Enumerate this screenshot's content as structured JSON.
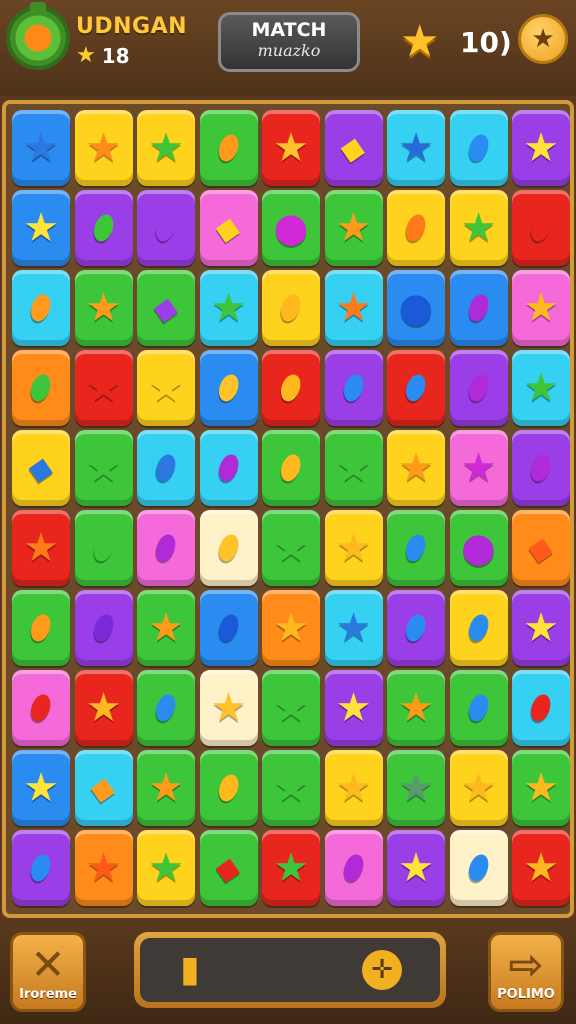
{
  "header": {
    "player_name": "UDNGAN",
    "stars": "18",
    "title_main": "MATCH",
    "title_sub": "muazko",
    "moves": "10)",
    "gear_icon": "gear-icon",
    "star_icon": "star-icon"
  },
  "colors": {
    "blue": "#2a8cf0",
    "cyan": "#35d0f2",
    "yellow": "#ffd21e",
    "green": "#3ec63a",
    "red": "#e8261e",
    "purple": "#9a3ee8",
    "pink": "#f36ad8",
    "orange": "#ff8c1a",
    "cream": "#fff1c8"
  },
  "gems": {
    "star": "★",
    "drop": "⬮",
    "diamond": "◆",
    "circle": "●"
  },
  "board": [
    [
      [
        "blue",
        "star",
        "#2a78e0"
      ],
      [
        "yellow",
        "star",
        "#ff8c1a"
      ],
      [
        "yellow",
        "star",
        "#3ec63a"
      ],
      [
        "green",
        "drop",
        "#ff9a1a"
      ],
      [
        "red",
        "star",
        "#ffc22a"
      ],
      [
        "purple",
        "diamond",
        "#ffd21e"
      ],
      [
        "cyan",
        "star",
        "#2a6ad8"
      ],
      [
        "cyan",
        "drop",
        "#2a8cf0"
      ],
      [
        "purple",
        "star",
        "#ffe23a"
      ]
    ],
    [
      [
        "blue",
        "star",
        "#ffe23a"
      ],
      [
        "purple",
        "drop",
        "#3ec63a"
      ],
      [
        "purple",
        "drop",
        "#9a3ee8"
      ],
      [
        "pink",
        "diamond",
        "#ffd21e"
      ],
      [
        "green",
        "circle",
        "#d02ad8"
      ],
      [
        "green",
        "star",
        "#ff9a1a"
      ],
      [
        "yellow",
        "drop",
        "#ff7a1a"
      ],
      [
        "yellow",
        "star",
        "#3ec63a"
      ],
      [
        "red",
        "drop",
        "#e8261e"
      ]
    ],
    [
      [
        "cyan",
        "drop",
        "#ff9a1a"
      ],
      [
        "green",
        "star",
        "#ff9a1a"
      ],
      [
        "green",
        "diamond",
        "#9a3ee8"
      ],
      [
        "cyan",
        "star",
        "#3ec63a"
      ],
      [
        "yellow",
        "drop",
        "#ffb81e"
      ],
      [
        "cyan",
        "star",
        "#ff7a1a"
      ],
      [
        "blue",
        "circle",
        "#1a5ad8"
      ],
      [
        "blue",
        "drop",
        "#b02ad8"
      ],
      [
        "pink",
        "star",
        "#ffb81e"
      ]
    ],
    [
      [
        "orange",
        "drop",
        "#3ec63a"
      ],
      [
        "red",
        "star",
        "#e8261e"
      ],
      [
        "yellow",
        "star",
        "#ffd21e"
      ],
      [
        "blue",
        "drop",
        "#ffc22a"
      ],
      [
        "red",
        "drop",
        "#ffb81e"
      ],
      [
        "purple",
        "drop",
        "#2a8cf0"
      ],
      [
        "red",
        "drop",
        "#2a8cf0"
      ],
      [
        "purple",
        "drop",
        "#b02ad8"
      ],
      [
        "cyan",
        "star",
        "#3ec63a"
      ]
    ],
    [
      [
        "yellow",
        "diamond",
        "#2a78e0"
      ],
      [
        "green",
        "star",
        "#3ec63a"
      ],
      [
        "cyan",
        "drop",
        "#2a78e0"
      ],
      [
        "cyan",
        "drop",
        "#b02ad8"
      ],
      [
        "green",
        "drop",
        "#ffb81e"
      ],
      [
        "green",
        "star",
        "#3ec63a"
      ],
      [
        "yellow",
        "star",
        "#ff9a1a"
      ],
      [
        "pink",
        "star",
        "#d02ad8"
      ],
      [
        "purple",
        "drop",
        "#b02ad8"
      ]
    ],
    [
      [
        "red",
        "star",
        "#ff7a1a"
      ],
      [
        "green",
        "drop",
        "#3ec63a"
      ],
      [
        "pink",
        "drop",
        "#b02ad8"
      ],
      [
        "cream",
        "drop",
        "#ffc22a"
      ],
      [
        "green",
        "star",
        "#3ec63a"
      ],
      [
        "yellow",
        "star",
        "#ffb81e"
      ],
      [
        "green",
        "drop",
        "#2a8cf0"
      ],
      [
        "green",
        "circle",
        "#b02ad8"
      ],
      [
        "orange",
        "diamond",
        "#ff5a1a"
      ]
    ],
    [
      [
        "green",
        "drop",
        "#ff9a1a"
      ],
      [
        "purple",
        "drop",
        "#7a2ad8"
      ],
      [
        "green",
        "star",
        "#ff9a1a"
      ],
      [
        "blue",
        "drop",
        "#1a5ad8"
      ],
      [
        "orange",
        "star",
        "#ffb81e"
      ],
      [
        "cyan",
        "star",
        "#2a78e0"
      ],
      [
        "purple",
        "drop",
        "#2a8cf0"
      ],
      [
        "yellow",
        "drop",
        "#2a8cf0"
      ],
      [
        "purple",
        "star",
        "#ffe23a"
      ]
    ],
    [
      [
        "pink",
        "drop",
        "#e8261e"
      ],
      [
        "red",
        "star",
        "#ffb81e"
      ],
      [
        "green",
        "drop",
        "#2a8cf0"
      ],
      [
        "cream",
        "star",
        "#ffc22a"
      ],
      [
        "green",
        "star",
        "#3ec63a"
      ],
      [
        "purple",
        "star",
        "#ffe23a"
      ],
      [
        "green",
        "star",
        "#ff9a1a"
      ],
      [
        "green",
        "drop",
        "#2a8cf0"
      ],
      [
        "cyan",
        "drop",
        "#e8261e"
      ]
    ],
    [
      [
        "blue",
        "star",
        "#ffe23a"
      ],
      [
        "cyan",
        "diamond",
        "#ff9a1a"
      ],
      [
        "green",
        "star",
        "#ff9a1a"
      ],
      [
        "green",
        "drop",
        "#ffb81e"
      ],
      [
        "green",
        "star",
        "#3ec63a"
      ],
      [
        "yellow",
        "star",
        "#ffb81e"
      ],
      [
        "green",
        "star",
        "#5a9a6a"
      ],
      [
        "yellow",
        "star",
        "#ffb81e"
      ],
      [
        "green",
        "star",
        "#ffb81e"
      ]
    ],
    [
      [
        "purple",
        "drop",
        "#2a8cf0"
      ],
      [
        "orange",
        "star",
        "#ff5a1a"
      ],
      [
        "yellow",
        "star",
        "#3ec63a"
      ],
      [
        "green",
        "diamond",
        "#e8261e"
      ],
      [
        "red",
        "star",
        "#3ec63a"
      ],
      [
        "pink",
        "drop",
        "#b02ad8"
      ],
      [
        "purple",
        "star",
        "#ffe23a"
      ],
      [
        "cream",
        "drop",
        "#2a8cf0"
      ],
      [
        "red",
        "star",
        "#ffb81e"
      ]
    ]
  ],
  "footer": {
    "left_label": "Iroreme",
    "right_label": "POLIMO",
    "left_icon": "close-icon",
    "right_icon": "arrow-right-icon",
    "left_glyph": "✕",
    "right_glyph": "⇨",
    "volume_glyph": "▮",
    "settings_glyph": "✛"
  }
}
